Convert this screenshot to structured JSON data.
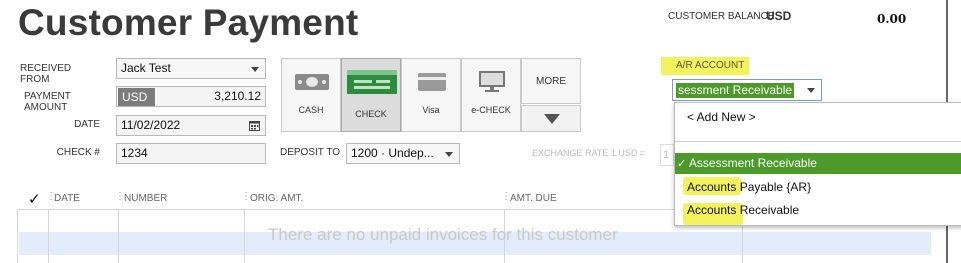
{
  "header": {
    "title": "Customer Payment"
  },
  "balance": {
    "label": "CUSTOMER BALANCE",
    "currency": "USD",
    "value": "0.00"
  },
  "form": {
    "received_from_label": "RECEIVED FROM",
    "received_from_value": "Jack Test",
    "payment_amount_label": "PAYMENT AMOUNT",
    "payment_currency": "USD",
    "payment_amount_value": "3,210.12",
    "date_label": "DATE",
    "date_value": "11/02/2022",
    "check_label": "CHECK #",
    "check_value": "1234",
    "deposit_to_label": "DEPOSIT TO",
    "deposit_to_value": "1200 · Undep..."
  },
  "payment_methods": [
    {
      "label": "CASH",
      "icon": "cash-icon"
    },
    {
      "label": "CHECK",
      "icon": "check-icon",
      "selected": true
    },
    {
      "label": "Visa",
      "icon": "credit-card-icon"
    },
    {
      "label": "e-CHECK",
      "icon": "echeck-icon"
    }
  ],
  "more_label": "MORE",
  "ar_account": {
    "label": "A/R ACCOUNT",
    "selected_value": "sessment Receivable",
    "options": [
      {
        "label": "< Add New >"
      },
      {
        "label": "Assessment Receivable",
        "selected": true,
        "check": "✓"
      },
      {
        "label": "Accounts Payable {AR}"
      },
      {
        "label": "Accounts Receivable"
      }
    ]
  },
  "exchange_rate": {
    "label": "EXCHANGE RATE 1 USD =",
    "value": "1"
  },
  "table": {
    "columns": [
      "✓",
      "DATE",
      "NUMBER",
      "ORIG. AMT.",
      "AMT. DUE"
    ],
    "empty_message": "There are no unpaid invoices for this customer"
  },
  "colors": {
    "highlight": "#f3f25a",
    "selected_green": "#4b9a2a",
    "stripe": "#e3ecfa"
  }
}
